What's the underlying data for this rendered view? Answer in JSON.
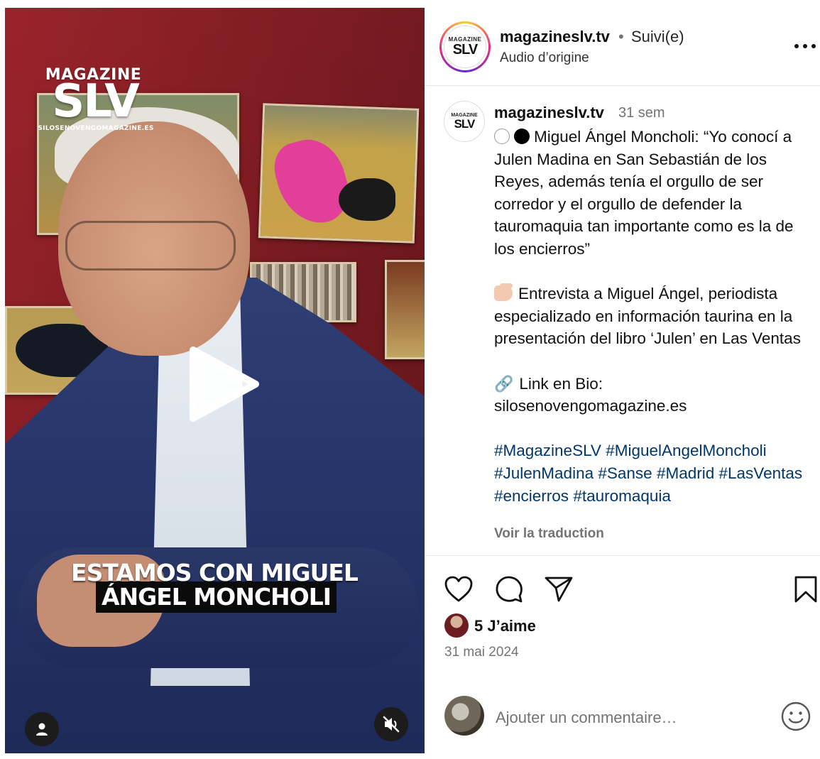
{
  "video": {
    "watermark_top": "MAGAZINE",
    "watermark_main": "SLV",
    "watermark_url": "SILOSENOVENGOMAGAZINE.ES",
    "caption_line1": "ESTAMOS CON MIGUEL",
    "caption_line2": "ÁNGEL MONCHOLI"
  },
  "header": {
    "avatar_top": "MAGAZINE",
    "avatar_main": "SLV",
    "username": "magazineslv.tv",
    "separator": "•",
    "follow_status": "Suivi(e)",
    "audio": "Audio d’origine"
  },
  "caption": {
    "avatar_top": "MAGAZINE",
    "avatar_main": "SLV",
    "username": "magazineslv.tv",
    "time": "31 sem",
    "line1": "Miguel Ángel Moncholi: “Yo conocí a Julen Madina en San Sebastián de los Reyes, además tenía el orgullo de ser corredor y el orgullo de defender la tauromaquia tan importante como es la de los encierros”",
    "line2": "Entrevista a Miguel Ángel, periodista especializado en información taurina en la presentación del libro ‘Julen’ en Las Ventas",
    "line3_prefix": "Link en Bio:",
    "line3_url": "silosenovengomagazine.es",
    "hashtags": [
      "#MagazineSLV",
      "#MiguelAngelMoncholi",
      "#JulenMadina",
      "#Sanse",
      "#Madrid",
      "#LasVentas",
      "#encierros",
      "#tauromaquia"
    ],
    "translate": "Voir la traduction"
  },
  "actions": {
    "like_icon": "heart-icon",
    "comment_icon": "comment-icon",
    "share_icon": "send-icon",
    "save_icon": "bookmark-icon"
  },
  "stats": {
    "likes": "5 J’aime",
    "date": "31 mai 2024"
  },
  "comment": {
    "placeholder": "Ajouter un commentaire…"
  },
  "colors": {
    "hashtag": "#00376b",
    "muted": "#737373"
  }
}
